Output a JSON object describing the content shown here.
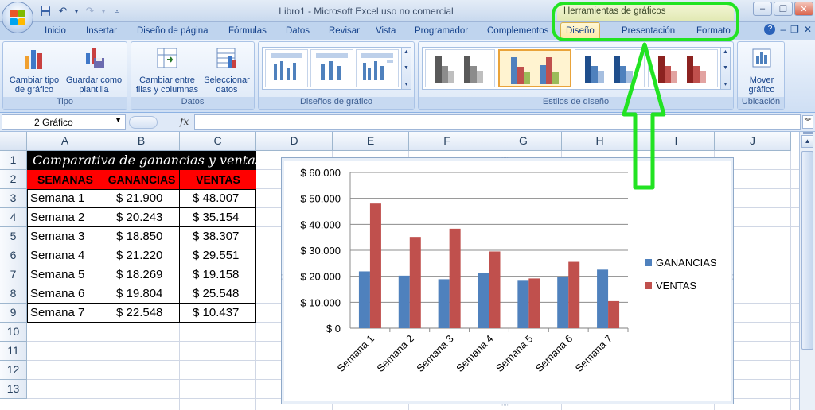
{
  "window": {
    "title": "Libro1 - Microsoft Excel uso no comercial",
    "tools_title": "Herramientas de gráficos"
  },
  "tabs": [
    {
      "label": "Inicio",
      "active": false
    },
    {
      "label": "Insertar",
      "active": false
    },
    {
      "label": "Diseño de página",
      "active": false
    },
    {
      "label": "Fórmulas",
      "active": false
    },
    {
      "label": "Datos",
      "active": false
    },
    {
      "label": "Revisar",
      "active": false
    },
    {
      "label": "Vista",
      "active": false
    },
    {
      "label": "Programador",
      "active": false
    },
    {
      "label": "Complementos",
      "active": false
    },
    {
      "label": "Diseño",
      "active": true
    },
    {
      "label": "Presentación",
      "active": false
    },
    {
      "label": "Formato",
      "active": false
    }
  ],
  "ribbon": {
    "groups": {
      "tipo": "Tipo",
      "datos": "Datos",
      "disenos": "Diseños de gráfico",
      "estilos": "Estilos de diseño",
      "ubicacion": "Ubicación"
    },
    "buttons": {
      "cambiar_tipo_1": "Cambiar tipo",
      "cambiar_tipo_2": "de gráfico",
      "guardar_1": "Guardar como",
      "guardar_2": "plantilla",
      "cambiar_filas_1": "Cambiar entre",
      "cambiar_filas_2": "filas y columnas",
      "seleccionar_1": "Seleccionar",
      "seleccionar_2": "datos",
      "mover_1": "Mover",
      "mover_2": "gráfico"
    }
  },
  "formula_bar": {
    "name_box": "2 Gráfico",
    "fx": "fx",
    "value": ""
  },
  "columns": [
    "A",
    "B",
    "C",
    "D",
    "E",
    "F",
    "G",
    "H",
    "I",
    "J"
  ],
  "rows": [
    "1",
    "2",
    "3",
    "4",
    "5",
    "6",
    "7",
    "8",
    "9",
    "10",
    "11",
    "12",
    "13"
  ],
  "sheet": {
    "title": "Comparativa de ganancias y ventas",
    "headers": [
      "SEMANAS",
      "GANANCIAS",
      "VENTAS"
    ],
    "data": [
      [
        "Semana 1",
        "$ 21.900",
        "$ 48.007"
      ],
      [
        "Semana 2",
        "$ 20.243",
        "$ 35.154"
      ],
      [
        "Semana 3",
        "$ 18.850",
        "$ 38.307"
      ],
      [
        "Semana 4",
        "$ 21.220",
        "$ 29.551"
      ],
      [
        "Semana 5",
        "$ 18.269",
        "$ 19.158"
      ],
      [
        "Semana 6",
        "$ 19.804",
        "$ 25.548"
      ],
      [
        "Semana 7",
        "$ 22.548",
        "$ 10.437"
      ]
    ]
  },
  "colors": {
    "ganancias": "#4f81bd",
    "ventas": "#c0504d",
    "header_red": "#ff0000",
    "title_black": "#000000",
    "annotation_green": "#22e322"
  },
  "chart_data": {
    "type": "bar",
    "categories": [
      "Semana 1",
      "Semana 2",
      "Semana 3",
      "Semana 4",
      "Semana 5",
      "Semana 6",
      "Semana 7"
    ],
    "series": [
      {
        "name": "GANANCIAS",
        "values": [
          21900,
          20243,
          18850,
          21220,
          18269,
          19804,
          22548
        ]
      },
      {
        "name": "VENTAS",
        "values": [
          48007,
          35154,
          38307,
          29551,
          19158,
          25548,
          10437
        ]
      }
    ],
    "ytick_labels": [
      "$ 0",
      "$ 10.000",
      "$ 20.000",
      "$ 30.000",
      "$ 40.000",
      "$ 50.000",
      "$ 60.000"
    ],
    "ylim": [
      0,
      60000
    ],
    "grid": true,
    "legend": "right"
  }
}
